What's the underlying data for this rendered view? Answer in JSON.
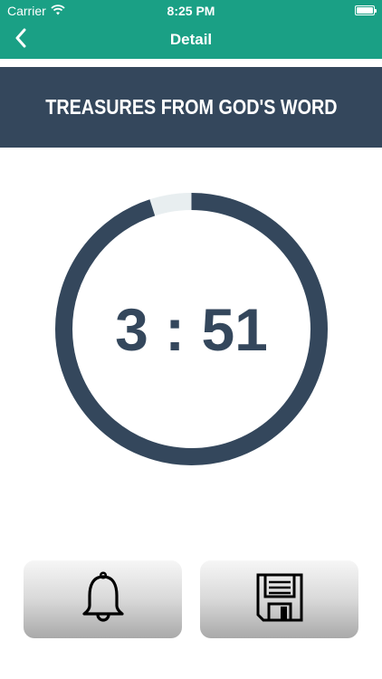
{
  "status_bar": {
    "carrier": "Carrier",
    "time": "8:25 PM"
  },
  "nav": {
    "title": "Detail",
    "back_icon": "chevron-left-icon"
  },
  "header": {
    "title": "TREASURES FROM GOD'S WORD"
  },
  "timer": {
    "display": "3 : 51",
    "progress_fraction": 0.95,
    "ring_color": "#34475c",
    "track_color": "#e8eef0"
  },
  "actions": {
    "alarm_icon": "bell-icon",
    "save_icon": "floppy-disk-icon"
  },
  "colors": {
    "accent": "#1aa085",
    "banner": "#34475c"
  }
}
